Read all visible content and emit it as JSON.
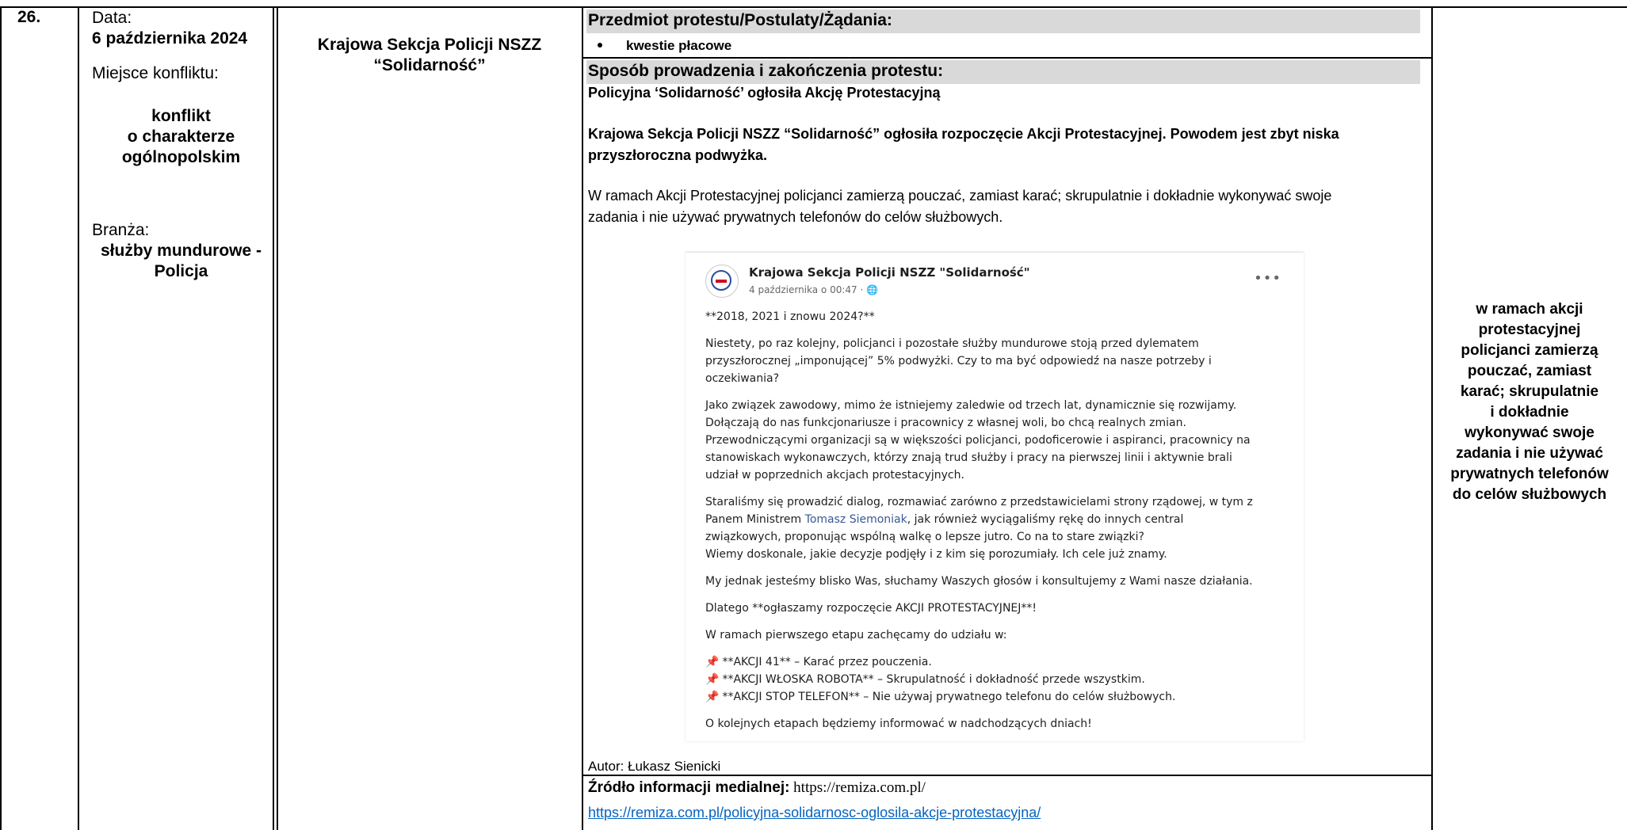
{
  "row_number": "26.",
  "date": {
    "label": "Data:",
    "value": "6 października 2024"
  },
  "place": {
    "label": "Miejsce konfliktu:",
    "lines": [
      "konflikt",
      "o charakterze",
      "ogólnopolskim"
    ]
  },
  "industry": {
    "label": "Branża:",
    "lines": [
      "służby mundurowe -",
      "Policja"
    ]
  },
  "organization": [
    "Krajowa Sekcja Policji NSZZ",
    "“Solidarność”"
  ],
  "subject": {
    "header": "Przedmiot protestu/Postulaty/Żądania:",
    "bullets": [
      "kwestie płacowe"
    ]
  },
  "method": {
    "header": "Sposób prowadzenia i zakończenia protestu:",
    "title": "Policyjna ‘Solidarność’ ogłosiła Akcję Protestacyjną",
    "lead_1": "Krajowa Sekcja Policji NSZZ “Solidarność” ogłosiła rozpoczęcie Akcji Protestacyjnej. Powodem jest zbyt niska",
    "lead_2": "przyszłoroczna podwyżka.",
    "body_1": "W ramach Akcji Protestacyjnej policjanci zamierzą pouczać, zamiast karać; skrupulatnie i dokładnie wykonywać swoje",
    "body_2": "zadania i nie używać prywatnych telefonów do celów służbowych."
  },
  "post": {
    "author": "Krajowa Sekcja Policji NSZZ \"Solidarność\"",
    "meta": "4 października o 00:47 · 🌐",
    "more": "•••",
    "heading": "**2018, 2021 i znowu 2024?**",
    "p1": [
      "Niestety, po raz kolejny, policjanci i pozostałe służby mundurowe stoją przed dylematem",
      "przyszłorocznej „imponującej” 5% podwyżki. Czy to ma być odpowiedź na nasze potrzeby i",
      "oczekiwania?"
    ],
    "p2": [
      "Jako związek zawodowy, mimo że istniejemy zaledwie od trzech lat, dynamicznie się rozwijamy.",
      "Dołączają do nas funkcjonariusze i pracownicy z własnej woli, bo chcą realnych zmian.",
      "Przewodniczącymi organizacji są w większości policjanci, podoficerowie i aspiranci, pracownicy na",
      "stanowiskach wykonawczych, którzy znają trud służby i pracy na pierwszej linii i aktywnie brali",
      "udział w poprzednich akcjach protestacyjnych."
    ],
    "p3_a": "Staraliśmy się prowadzić dialog, rozmawiać zarówno z przedstawicielami strony rządowej, w tym z",
    "p3_b_pre": "Panem Ministrem ",
    "p3_b_link": "Tomasz Siemoniak",
    "p3_b_post": ", jak również wyciągaliśmy rękę do innych central",
    "p3_c": "związkowych, proponując wspólną walkę o lepsze jutro. Co na to stare związki?",
    "p3_d": "Wiemy doskonale, jakie decyzje podjęły i z kim się porozumiały. Ich cele już znamy.",
    "p4": "My jednak jesteśmy blisko Was, słuchamy Waszych głosów i konsultujemy z Wami nasze działania.",
    "p5": "Dlatego **ogłaszamy rozpoczęcie AKCJI PROTESTACYJNEJ**!",
    "p6": "W ramach pierwszego etapu zachęcamy do udziału w:",
    "items": [
      "**AKCJI 41** – Karać przez pouczenia.",
      "**AKCJI WŁOSKA ROBOTA** – Skrupulatność i dokładność przede wszystkim.",
      "**AKCJI STOP TELEFON** – Nie używaj prywatnego telefonu do celów służbowych."
    ],
    "p7": "O kolejnych etapach będziemy informować w nadchodzących dniach!"
  },
  "author_line": "Autor:  Łukasz Sienicki",
  "source": {
    "label": "Źródło informacji medialnej:",
    "site": " https://remiza.com.pl/",
    "link": "https://remiza.com.pl/policyjna-solidarnosc-oglosila-akcje-protestacyjna/"
  },
  "summary": [
    "w ramach akcji",
    "protestacyjnej",
    "policjanci zamierzą",
    "pouczać, zamiast",
    "karać; skrupulatnie",
    "i dokładnie",
    "wykonywać swoje",
    "zadania i nie używać",
    "prywatnych telefonów",
    "do celów służbowych"
  ]
}
